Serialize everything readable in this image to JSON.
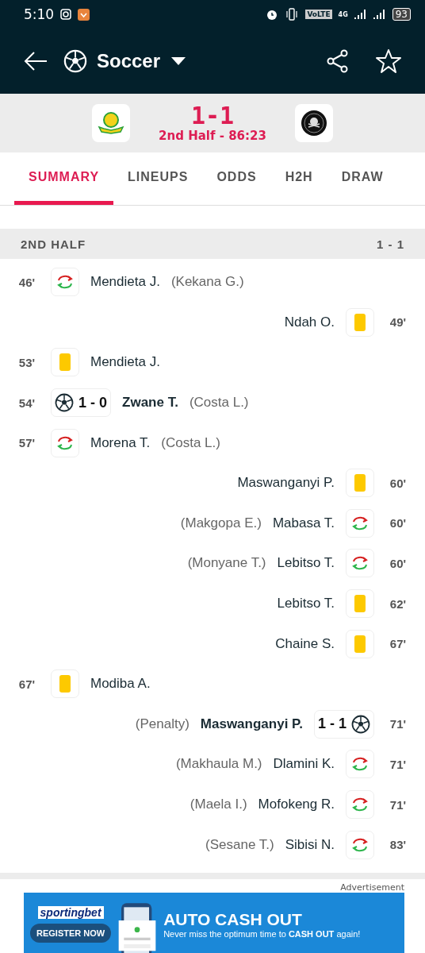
{
  "status_bar": {
    "time": "5:10",
    "network": "4G",
    "volte": "VoLTE",
    "battery": "93"
  },
  "app_bar": {
    "title": "Soccer"
  },
  "match": {
    "score": "1-1",
    "status": "2nd Half - 86:23"
  },
  "tabs": [
    {
      "label": "SUMMARY",
      "selected": true
    },
    {
      "label": "LINEUPS",
      "selected": false
    },
    {
      "label": "ODDS",
      "selected": false
    },
    {
      "label": "H2H",
      "selected": false
    },
    {
      "label": "DRAW",
      "selected": false
    }
  ],
  "section": {
    "title": "2ND HALF",
    "score": "1 - 1"
  },
  "events": [
    {
      "away": false,
      "minute": "46'",
      "kind": "substitution",
      "player": "Mendieta J.",
      "note": "(Kekana G.)"
    },
    {
      "away": true,
      "minute": "49'",
      "kind": "booking",
      "player": "Ndah O."
    },
    {
      "away": false,
      "minute": "53'",
      "kind": "booking",
      "player": "Mendieta J."
    },
    {
      "away": false,
      "minute": "54'",
      "kind": "goal",
      "score": "1 - 0",
      "player": "Zwane T.",
      "note": "(Costa L.)"
    },
    {
      "away": false,
      "minute": "57'",
      "kind": "substitution",
      "player": "Morena T.",
      "note": "(Costa L.)"
    },
    {
      "away": true,
      "minute": "60'",
      "kind": "booking",
      "player": "Maswanganyi P."
    },
    {
      "away": true,
      "minute": "60'",
      "kind": "substitution",
      "player": "Mabasa T.",
      "note": "(Makgopa E.)"
    },
    {
      "away": true,
      "minute": "60'",
      "kind": "substitution",
      "player": "Lebitso T.",
      "note": "(Monyane T.)"
    },
    {
      "away": true,
      "minute": "62'",
      "kind": "booking",
      "player": "Lebitso T."
    },
    {
      "away": true,
      "minute": "67'",
      "kind": "booking",
      "player": "Chaine S."
    },
    {
      "away": false,
      "minute": "67'",
      "kind": "booking",
      "player": "Modiba A."
    },
    {
      "away": true,
      "minute": "71'",
      "kind": "goal",
      "score": "1 - 1",
      "player": "Maswanganyi P.",
      "note": "(Penalty)"
    },
    {
      "away": true,
      "minute": "71'",
      "kind": "substitution",
      "player": "Dlamini K.",
      "note": "(Makhaula M.)"
    },
    {
      "away": true,
      "minute": "71'",
      "kind": "substitution",
      "player": "Mofokeng R.",
      "note": "(Maela I.)"
    },
    {
      "away": true,
      "minute": "83'",
      "kind": "substitution",
      "player": "Sibisi N.",
      "note": "(Sesane T.)"
    }
  ],
  "advert": {
    "label": "Advertisement",
    "brand": "sportingbet",
    "button": "REGISTER NOW",
    "headline": "AUTO CASH OUT",
    "tagline": "Never miss the optimum time to **CASH OUT** again!"
  }
}
